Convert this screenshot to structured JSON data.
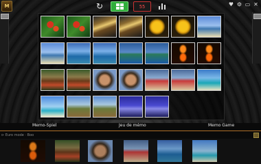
{
  "toolbar": {
    "logo_text": "M",
    "refresh_icon": "refresh-icon",
    "grid_icon": "grid-icon",
    "timer_text": "55",
    "stats_icon": "bar-chart-icon",
    "window_controls": [
      "♥",
      "⚙",
      "▭",
      "✕"
    ]
  },
  "colors": {
    "grid_active": "#2fae3a",
    "timer_red": "#ff4a4a",
    "divider_orange": "#b0702a"
  },
  "board": {
    "rows": [
      [
        "flowers-red",
        "flowers-red",
        "dancers-gold",
        "dancers-gold",
        "yellow-flower",
        "yellow-flower",
        "beach-sky"
      ],
      [
        "beach-sky",
        "sea-blue",
        "sea-blue",
        "island-boat",
        "island-boat",
        "fire-dancer",
        "fire-dancer"
      ],
      [
        "hut-green",
        "hut-green",
        "child-face",
        "child-face",
        "couple-beach",
        "couple-beach",
        "lagoon"
      ],
      [
        "palm-beach",
        "village-huts",
        "village-huts",
        "blue-dusk",
        "blue-dusk"
      ]
    ]
  },
  "labels": {
    "left": "Memo-Spiel",
    "center": "Jeu de mémo",
    "right": "Memo Game"
  },
  "status": {
    "text": "⊳ Euro mode · Boo"
  },
  "tray": {
    "items": [
      "fire-dancer",
      "hut-green",
      "child-face",
      "couple-beach",
      "sea-blue",
      "palm-beach"
    ]
  }
}
